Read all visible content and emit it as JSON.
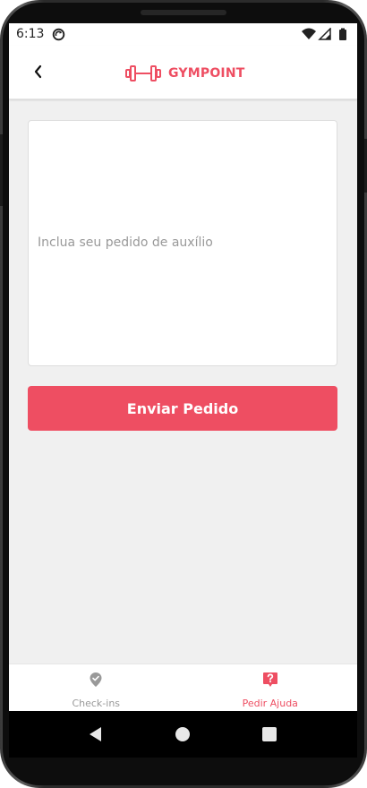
{
  "status_bar": {
    "time": "6:13",
    "sync_icon": "sync-icon",
    "wifi_icon": "wifi-icon",
    "signal_icon": "signal-icon",
    "battery_icon": "battery-icon"
  },
  "header": {
    "back_icon": "chevron-left-icon",
    "logo_icon": "dumbbell-icon",
    "logo_text": "GYMPOINT"
  },
  "form": {
    "placeholder": "Inclua seu pedido de auxílio",
    "value": "",
    "submit_label": "Enviar Pedido"
  },
  "tabs": [
    {
      "label": "Check-ins",
      "icon": "map-pin-check-icon",
      "active": false
    },
    {
      "label": "Pedir Ajuda",
      "icon": "help-icon",
      "active": true
    }
  ],
  "nav": {
    "back_icon": "triangle-back-icon",
    "home_icon": "circle-home-icon",
    "recents_icon": "square-recents-icon"
  },
  "colors": {
    "accent": "#ee4e62",
    "inactive": "#999999",
    "background": "#f0f0f0"
  }
}
